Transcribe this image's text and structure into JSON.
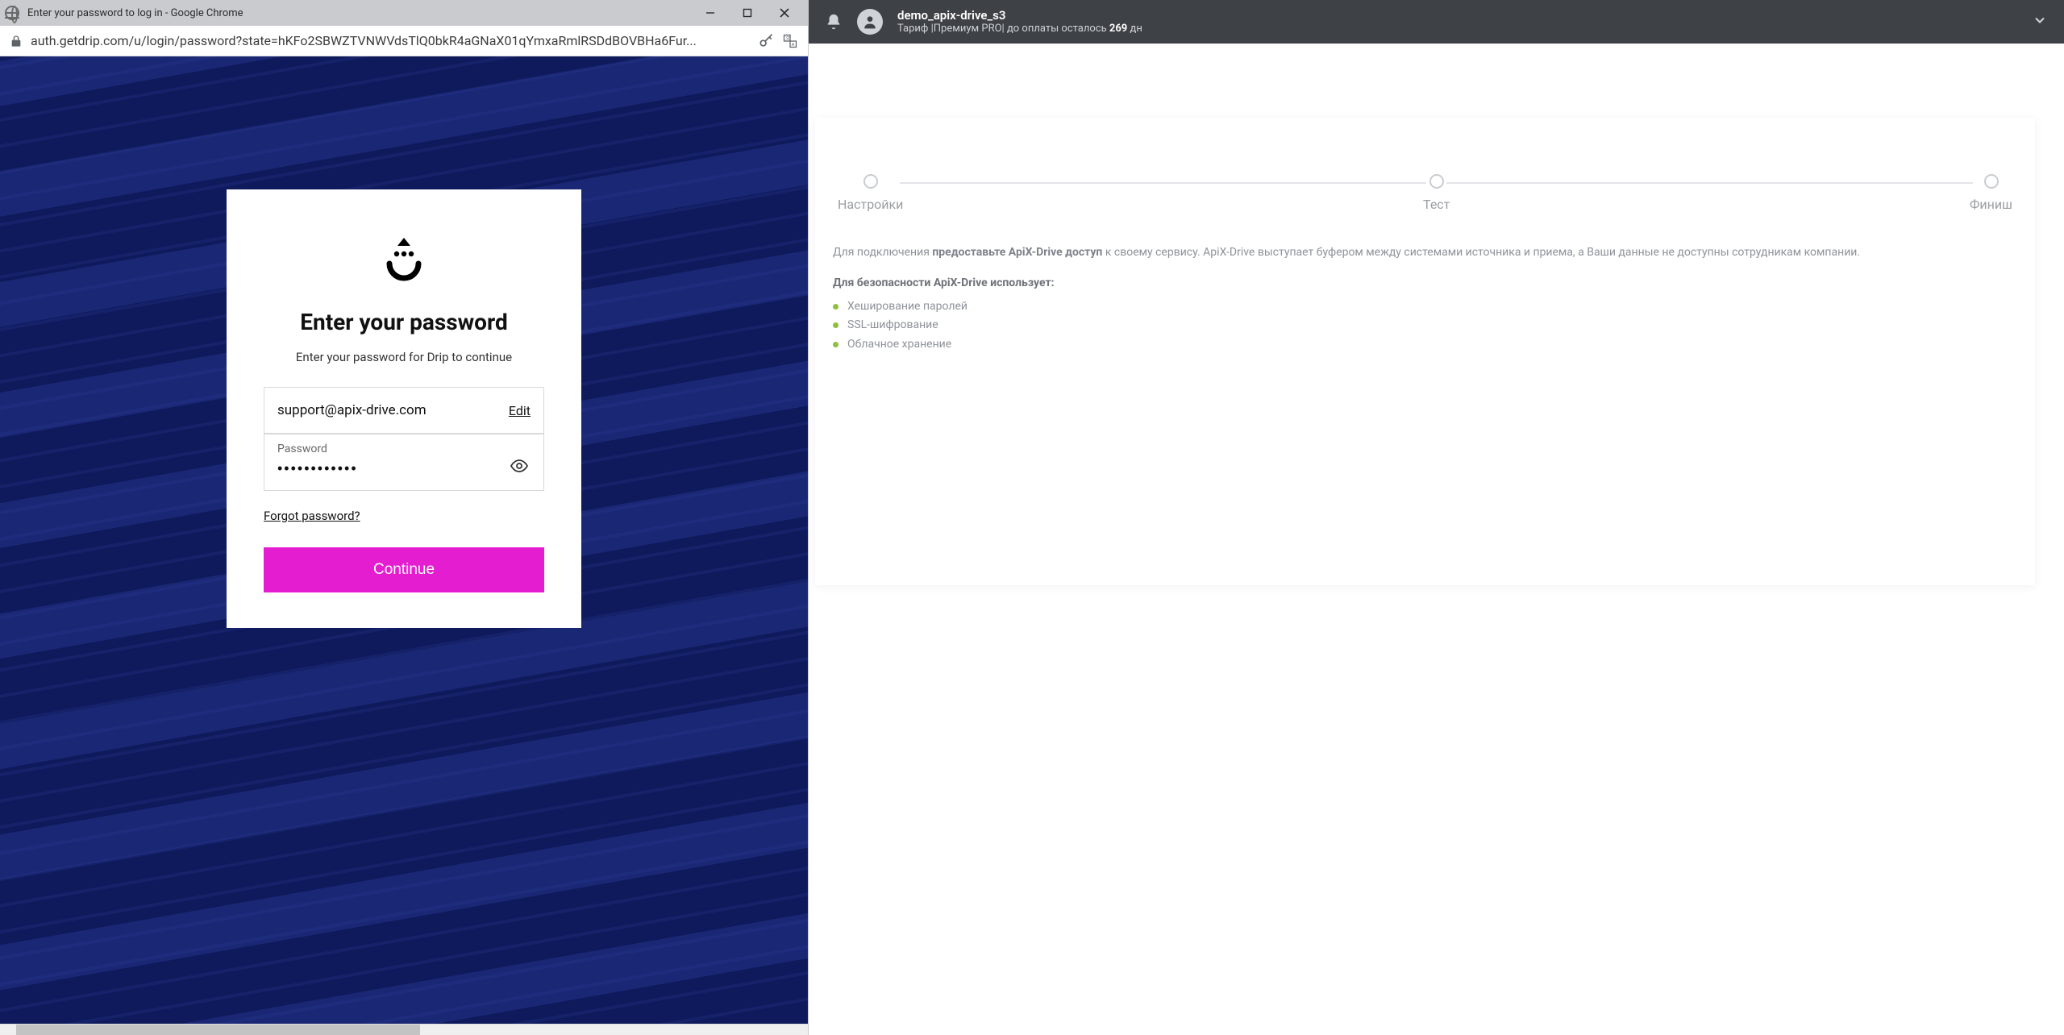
{
  "chrome": {
    "title": "Enter your password to log in - Google Chrome",
    "url": "auth.getdrip.com/u/login/password?state=hKFo2SBWZTVNWVdsTlQ0bkR4aGNaX01qYmxaRmlRSDdBOVBHa6Fur..."
  },
  "login": {
    "heading": "Enter your password",
    "subheading": "Enter your password for Drip to continue",
    "email": "support@apix-drive.com",
    "edit_label": "Edit",
    "password_label": "Password",
    "password_value": "••••••••••••",
    "forgot_label": "Forgot password?",
    "continue_label": "Continue"
  },
  "topbar": {
    "username": "demo_apix-drive_s3",
    "tariff_prefix": "Тариф |",
    "tariff_plan": "Премиум PRO",
    "tariff_suffix": "|  до оплаты осталось ",
    "days": "269",
    "days_unit": " дн"
  },
  "wizard": {
    "steps": [
      "Настройки",
      "Тест",
      "Финиш"
    ],
    "desc_prefix": "Для подключения ",
    "desc_bold": "предоставьте ApiX-Drive доступ",
    "desc_suffix": " к своему сервису. ApiX-Drive выступает буфером между системами источника и приема, а Ваши данные не доступны сотрудникам компании.",
    "security_title": "Для безопасности ApiX-Drive использует:",
    "bullets": [
      "Хеширование паролей",
      "SSL-шифрование",
      "Облачное хранение"
    ]
  }
}
